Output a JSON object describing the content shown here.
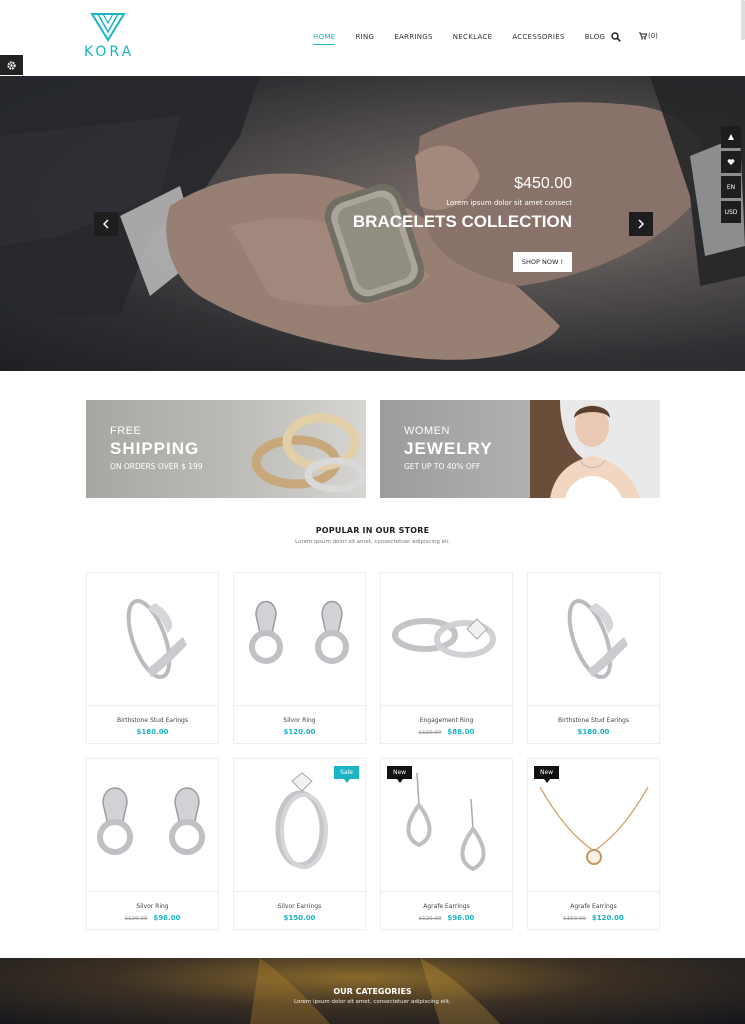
{
  "brand": {
    "name": "KORA",
    "accent": "#19b5c4"
  },
  "nav": {
    "items": [
      {
        "label": "HOME",
        "active": true
      },
      {
        "label": "RING",
        "active": false
      },
      {
        "label": "EARRINGS",
        "active": false
      },
      {
        "label": "NECKLACE",
        "active": false
      },
      {
        "label": "ACCESSORIES",
        "active": false
      },
      {
        "label": "BLOG",
        "active": false
      }
    ],
    "search_icon": "search-icon",
    "cart_count": "(0)"
  },
  "hero": {
    "price": "$450.00",
    "subtitle": "Lorem ipsum dolor sit amet consect",
    "title": "BRACELETS COLLECTION",
    "button": "SHOP NOW !",
    "side_tools": {
      "lang": "EN",
      "currency": "USD"
    }
  },
  "banners": [
    {
      "line1": "FREE",
      "line2": "SHIPPING",
      "line3": "ON ORDERS OVER $ 199"
    },
    {
      "line1": "WOMEN",
      "line2": "JEWELRY",
      "line3": "GET UP TO 40% OFF"
    }
  ],
  "popular": {
    "title": "POPULAR IN OUR STORE",
    "subtitle": "Lorem ipsum dolor sit amet, consectetuer adipiscing eli.",
    "products": [
      {
        "name": "Birthstone Stud Earings",
        "old_price": "",
        "price": "$180.00",
        "badge": ""
      },
      {
        "name": "Silvor Ring",
        "old_price": "",
        "price": "$120.00",
        "badge": ""
      },
      {
        "name": "Engagement Ring",
        "old_price": "$110.00",
        "price": "$88.00",
        "badge": ""
      },
      {
        "name": "Birthstone Stud Earings",
        "old_price": "",
        "price": "$180.00",
        "badge": ""
      },
      {
        "name": "Silvor Ring",
        "old_price": "$120.00",
        "price": "$96.00",
        "badge": ""
      },
      {
        "name": "Silvor Earrings",
        "old_price": "",
        "price": "$150.00",
        "badge": "Sale"
      },
      {
        "name": "Agrafe Earrings",
        "old_price": "$120.00",
        "price": "$96.00",
        "badge": "New"
      },
      {
        "name": "Agrafe Earrings",
        "old_price": "$150.00",
        "price": "$120.00",
        "badge": "New"
      }
    ]
  },
  "categories": {
    "title": "OUR CATEGORIES",
    "subtitle": "Lorem ipsum dolor sit amet, consectetuer adipiscing elit."
  }
}
